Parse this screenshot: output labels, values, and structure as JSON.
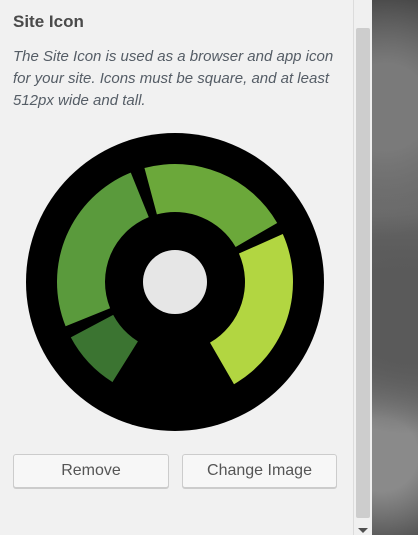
{
  "section": {
    "title": "Site Icon",
    "description": "The Site Icon is used as a browser and app icon for your site. Icons must be square, and at least 512px wide and tall."
  },
  "icon_preview": {
    "icon": "site-icon-logo",
    "colors": {
      "background": "#000000",
      "segment_dark": "#3b7431",
      "segment_medium": "#5a9a3c",
      "segment_top": "#6ba83a",
      "segment_light": "#b2d641",
      "center": "#e6e6e6"
    }
  },
  "actions": {
    "remove_label": "Remove",
    "change_image_label": "Change Image"
  },
  "scrollbar": {
    "up_icon": "scroll-up-icon",
    "down_icon": "scroll-down-icon"
  }
}
